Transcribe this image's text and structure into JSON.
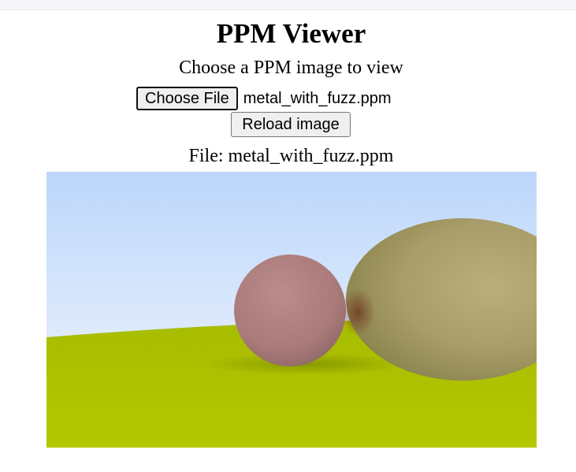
{
  "page": {
    "title": "PPM Viewer",
    "subtitle": "Choose a PPM image to view"
  },
  "file_picker": {
    "button_label": "Choose File",
    "selected_file": "metal_with_fuzz.ppm"
  },
  "reload_button": {
    "label": "Reload image"
  },
  "file_info": {
    "label": "File: metal_with_fuzz.ppm"
  },
  "image": {
    "description_colors": {
      "sky_top": "#b9d6fb",
      "sky_bottom": "#f2f6fd",
      "ground": "#b2c600",
      "pink_sphere": "#b08080",
      "gold_sphere": "#b4a874"
    }
  }
}
